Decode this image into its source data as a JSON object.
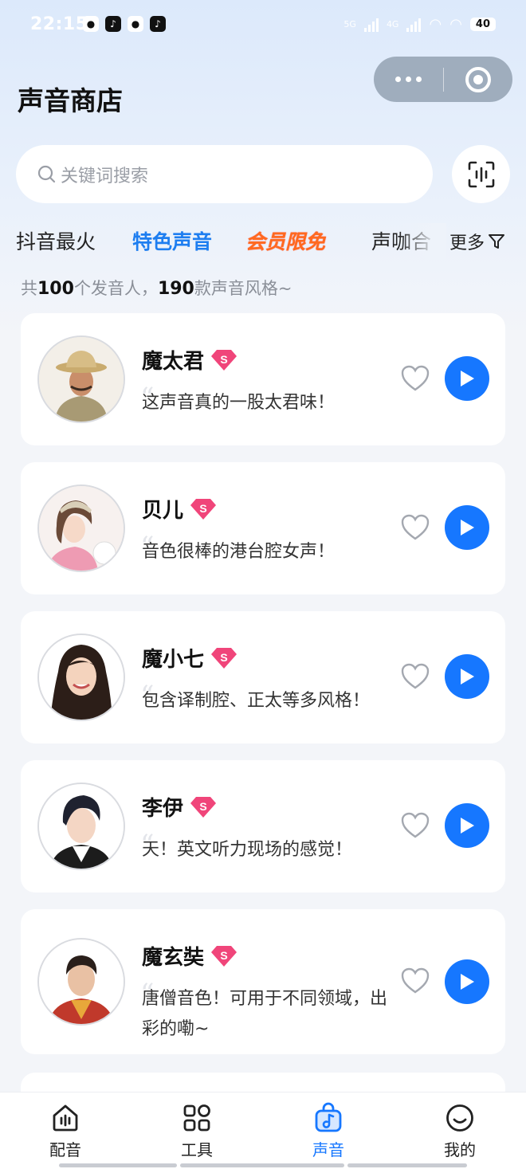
{
  "status_bar": {
    "time": "22:15",
    "network_1": "5G",
    "network_2": "4G",
    "battery": "40"
  },
  "header": {
    "title": "声音商店"
  },
  "search": {
    "placeholder": "关键词搜索"
  },
  "tabs": [
    {
      "label": "抖音最火"
    },
    {
      "label": "特色声音"
    },
    {
      "label": "会员限免"
    },
    {
      "label": "声咖合"
    }
  ],
  "more_label": "更多",
  "summary": {
    "prefix": "共",
    "speaker_count": "100",
    "middle": "个发音人，",
    "style_count": "190",
    "suffix": "款声音风格~"
  },
  "voices": [
    {
      "name": "魔太君",
      "desc": "这声音真的一股太君味！"
    },
    {
      "name": "贝儿",
      "desc": "音色很棒的港台腔女声！"
    },
    {
      "name": "魔小七",
      "desc": "包含译制腔、正太等多风格！"
    },
    {
      "name": "李伊",
      "desc": "天！英文听力现场的感觉！"
    },
    {
      "name": "魔玄奘",
      "desc": "唐僧音色！可用于不同领域，出彩的嘞~"
    }
  ],
  "nav": [
    {
      "label": "配音",
      "icon": "dubbing-icon"
    },
    {
      "label": "工具",
      "icon": "tools-icon"
    },
    {
      "label": "声音",
      "icon": "sound-icon"
    },
    {
      "label": "我的",
      "icon": "profile-icon"
    }
  ],
  "colors": {
    "accent": "#1677ff",
    "tab_active": "#1e7ef0",
    "tab_vip": "#ff6a1f",
    "badge": "#f0457a"
  }
}
